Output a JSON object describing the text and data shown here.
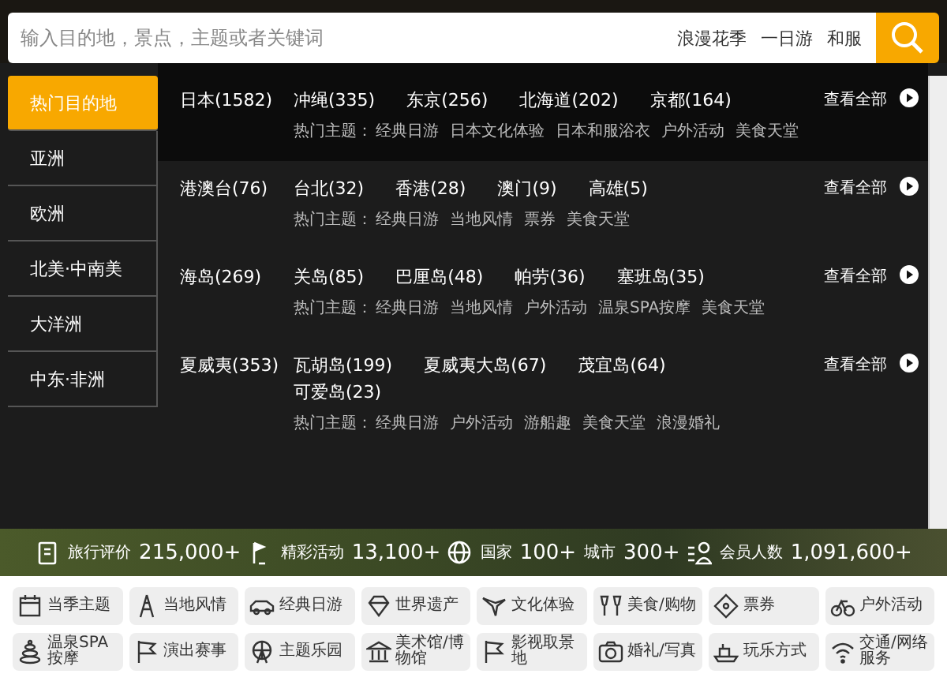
{
  "search": {
    "placeholder": "输入目的地，景点，主题或者关键词",
    "hot_keywords": [
      "浪漫花季",
      "一日游",
      "和服"
    ]
  },
  "regions": [
    {
      "label": "热门目的地",
      "selected": true
    },
    {
      "label": "亚洲",
      "selected": false
    },
    {
      "label": "欧洲",
      "selected": false
    },
    {
      "label": "北美·中南美",
      "selected": false
    },
    {
      "label": "大洋洲",
      "selected": false
    },
    {
      "label": "中东·非洲",
      "selected": false
    }
  ],
  "groups": [
    {
      "title": "日本(1582)",
      "destinations": [
        "冲绳(335)",
        "东京(256)",
        "北海道(202)",
        "京都(164)"
      ],
      "themes_label": "热门主题：",
      "themes": [
        "经典日游",
        "日本文化体验",
        "日本和服浴衣",
        "户外活动",
        "美食天堂"
      ],
      "more": "查看全部"
    },
    {
      "title": "港澳台(76)",
      "destinations": [
        "台北(32)",
        "香港(28)",
        "澳门(9)",
        "高雄(5)"
      ],
      "themes_label": "热门主题：",
      "themes": [
        "经典日游",
        "当地风情",
        "票券",
        "美食天堂"
      ],
      "more": "查看全部"
    },
    {
      "title": "海岛(269)",
      "destinations": [
        "关岛(85)",
        "巴厘岛(48)",
        "帕劳(36)",
        "塞班岛(35)"
      ],
      "themes_label": "热门主题：",
      "themes": [
        "经典日游",
        "当地风情",
        "户外活动",
        "温泉SPA按摩",
        "美食天堂"
      ],
      "more": "查看全部"
    },
    {
      "title": "夏威夷(353)",
      "destinations": [
        "瓦胡岛(199)",
        "夏威夷大岛(67)",
        "茂宜岛(64)",
        "可爱岛(23)"
      ],
      "themes_label": "热门主题：",
      "themes": [
        "经典日游",
        "户外活动",
        "游船趣",
        "美食天堂",
        "浪漫婚礼"
      ],
      "more": "查看全部"
    }
  ],
  "stats": [
    {
      "parts": [
        {
          "label": "旅行评价",
          "value": "215,000+"
        }
      ]
    },
    {
      "parts": [
        {
          "label": "精彩活动",
          "value": "13,100+"
        }
      ]
    },
    {
      "parts": [
        {
          "label": "国家",
          "value": "100+"
        },
        {
          "label": "城市",
          "value": "300+"
        }
      ]
    },
    {
      "parts": [
        {
          "label": "会员人数",
          "value": "1,091,600+"
        }
      ]
    }
  ],
  "categories": [
    {
      "label": "当季主题"
    },
    {
      "label": "当地风情"
    },
    {
      "label": "经典日游"
    },
    {
      "label": "世界遗产"
    },
    {
      "label": "文化体验"
    },
    {
      "label": "美食/购物"
    },
    {
      "label": "票券"
    },
    {
      "label": "户外活动"
    },
    {
      "label": "温泉SPA按摩"
    },
    {
      "label": "演出赛事"
    },
    {
      "label": "主题乐园"
    },
    {
      "label": "美术馆/博物馆"
    },
    {
      "label": "影视取景地"
    },
    {
      "label": "婚礼/写真"
    },
    {
      "label": "玩乐方式"
    },
    {
      "label": "交通/网络服务"
    }
  ]
}
